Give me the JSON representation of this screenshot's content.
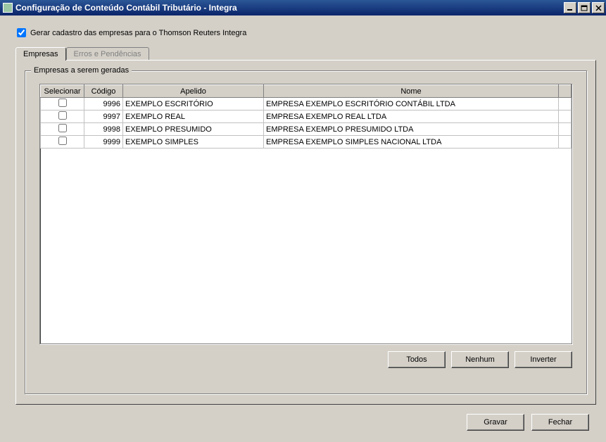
{
  "window": {
    "title": "Configuração de Conteúdo Contábil Tributário - Integra"
  },
  "checkbox": {
    "label": "Gerar cadastro das empresas para o Thomson Reuters Integra",
    "checked": true
  },
  "tabs": {
    "empresas": "Empresas",
    "erros": "Erros e Pendências"
  },
  "group": {
    "title": "Empresas a serem geradas"
  },
  "columns": {
    "selecionar": "Selecionar",
    "codigo": "Código",
    "apelido": "Apelido",
    "nome": "Nome"
  },
  "rows": [
    {
      "codigo": "9996",
      "apelido": "EXEMPLO ESCRITÓRIO",
      "nome": "EMPRESA EXEMPLO ESCRITÓRIO CONTÁBIL LTDA",
      "selected": false
    },
    {
      "codigo": "9997",
      "apelido": "EXEMPLO REAL",
      "nome": "EMPRESA EXEMPLO REAL LTDA",
      "selected": false
    },
    {
      "codigo": "9998",
      "apelido": "EXEMPLO PRESUMIDO",
      "nome": "EMPRESA EXEMPLO PRESUMIDO LTDA",
      "selected": false
    },
    {
      "codigo": "9999",
      "apelido": "EXEMPLO SIMPLES",
      "nome": "EMPRESA EXEMPLO SIMPLES NACIONAL LTDA",
      "selected": false
    }
  ],
  "buttons": {
    "todos": "Todos",
    "nenhum": "Nenhum",
    "inverter": "Inverter",
    "gravar": "Gravar",
    "fechar": "Fechar"
  }
}
